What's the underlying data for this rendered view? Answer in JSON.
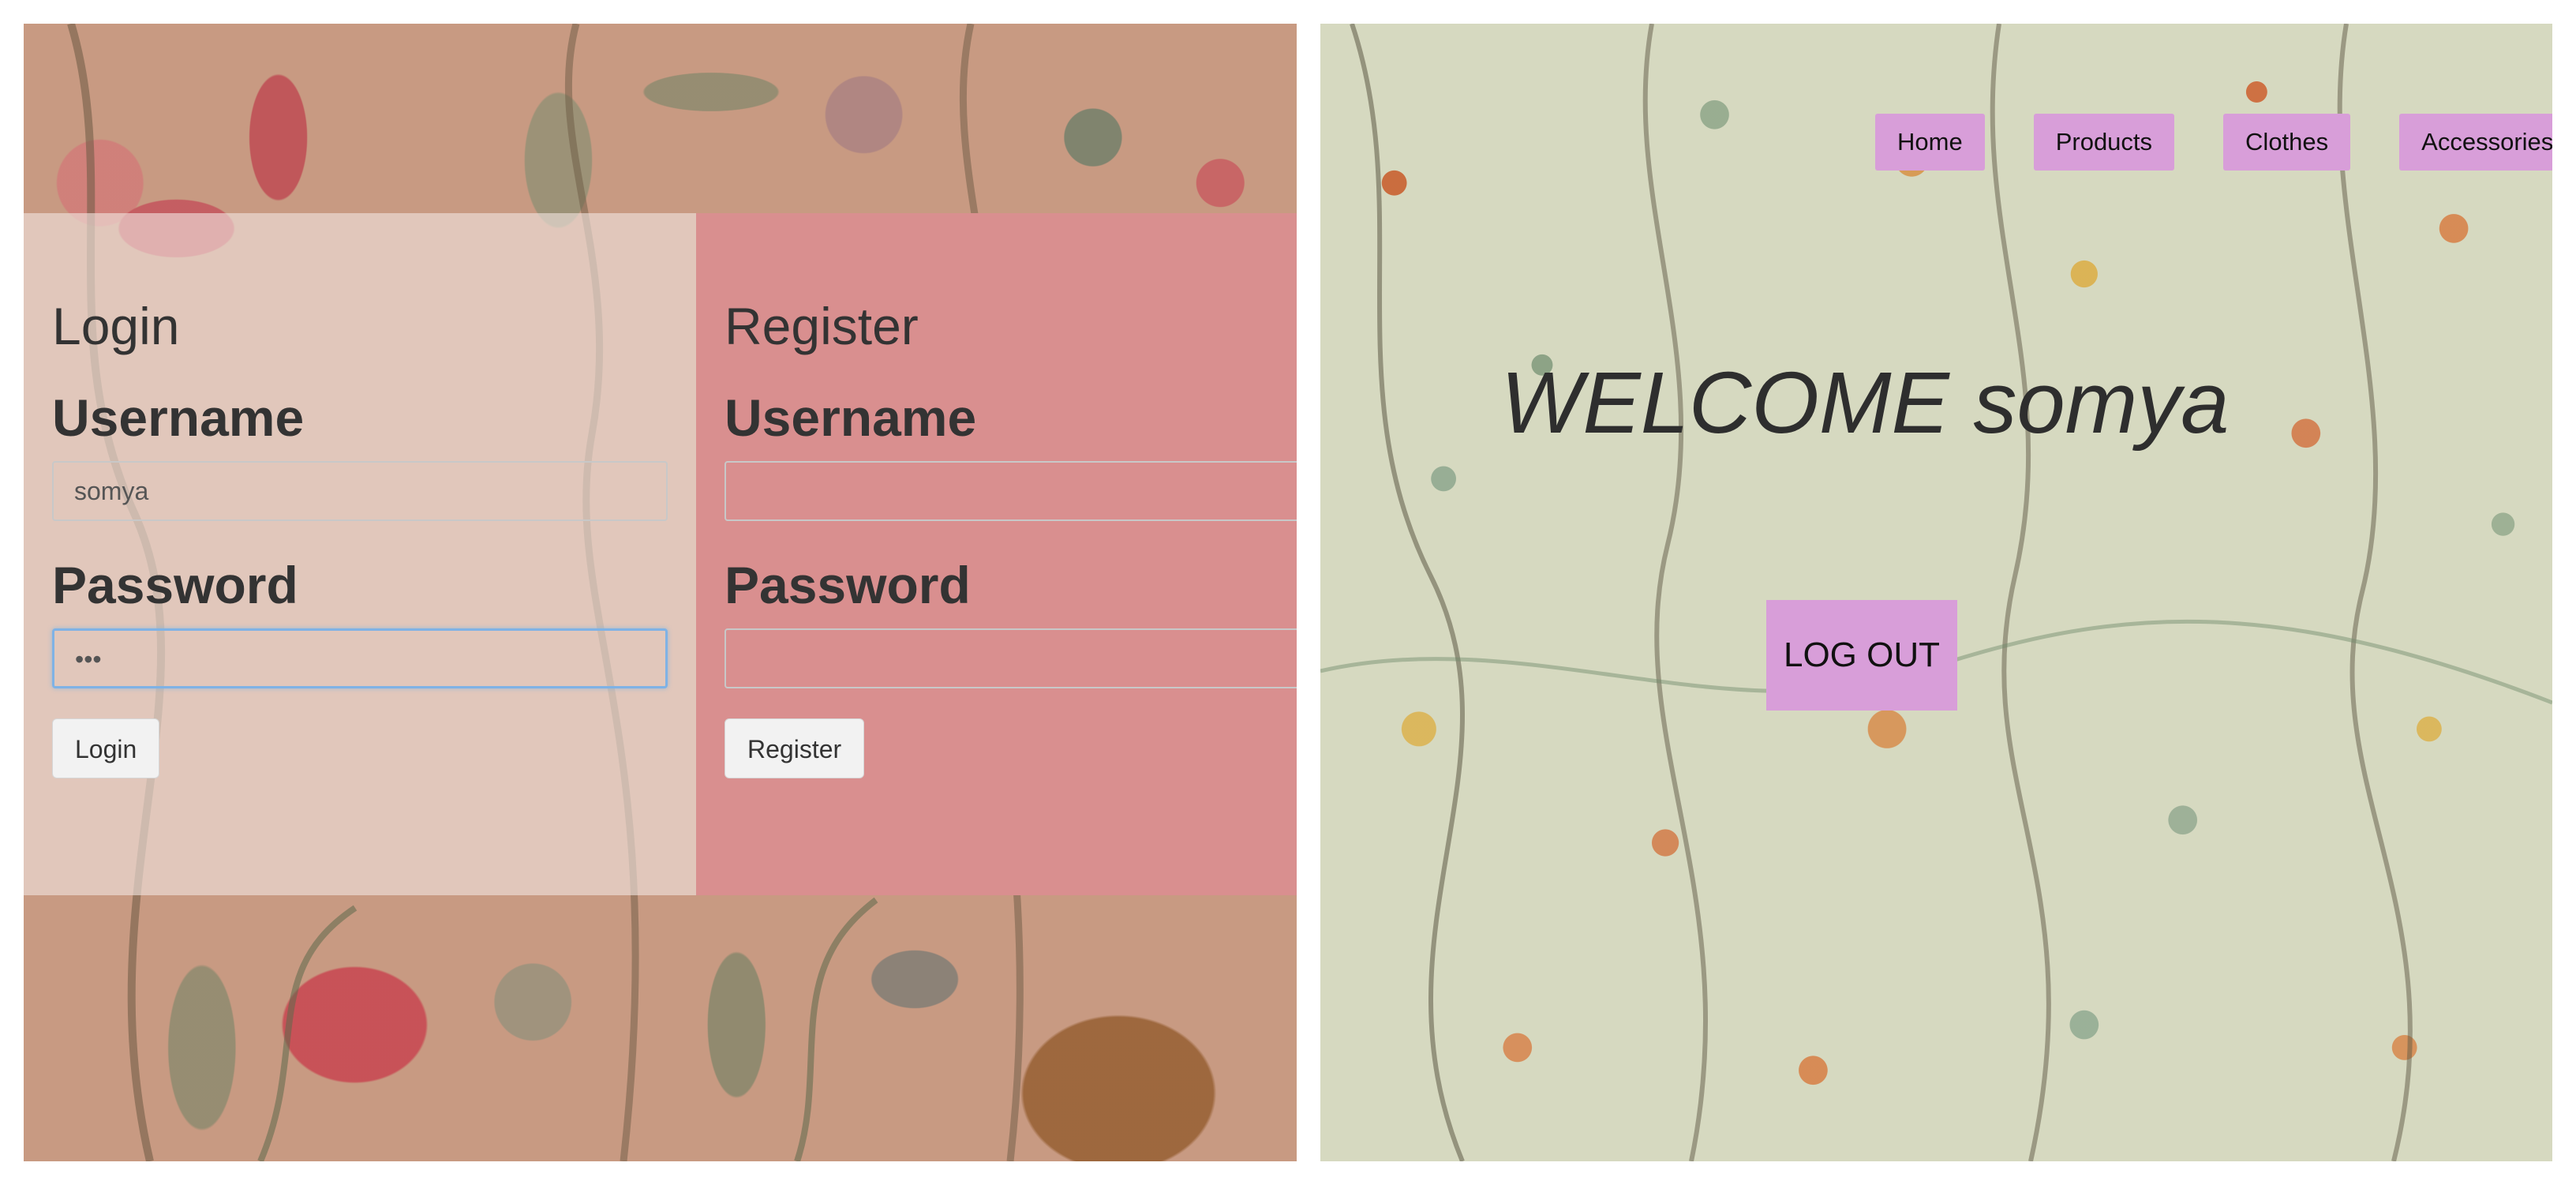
{
  "login": {
    "title": "Login",
    "username_label": "Username",
    "username_value": "somya",
    "password_label": "Password",
    "password_value": "•••",
    "button_label": "Login"
  },
  "register": {
    "title": "Register",
    "username_label": "Username",
    "username_value": "",
    "password_label": "Password",
    "password_value": "",
    "button_label": "Register"
  },
  "welcome_page": {
    "nav": [
      {
        "label": "Home"
      },
      {
        "label": "Products"
      },
      {
        "label": "Clothes"
      },
      {
        "label": "Accessories"
      }
    ],
    "heading": "WELCOME somya",
    "logout_label": "LOG OUT"
  },
  "colors": {
    "register_panel": "#d98f8f",
    "nav_button": "#d89ed9",
    "focus_ring": "#7fb2e5"
  }
}
